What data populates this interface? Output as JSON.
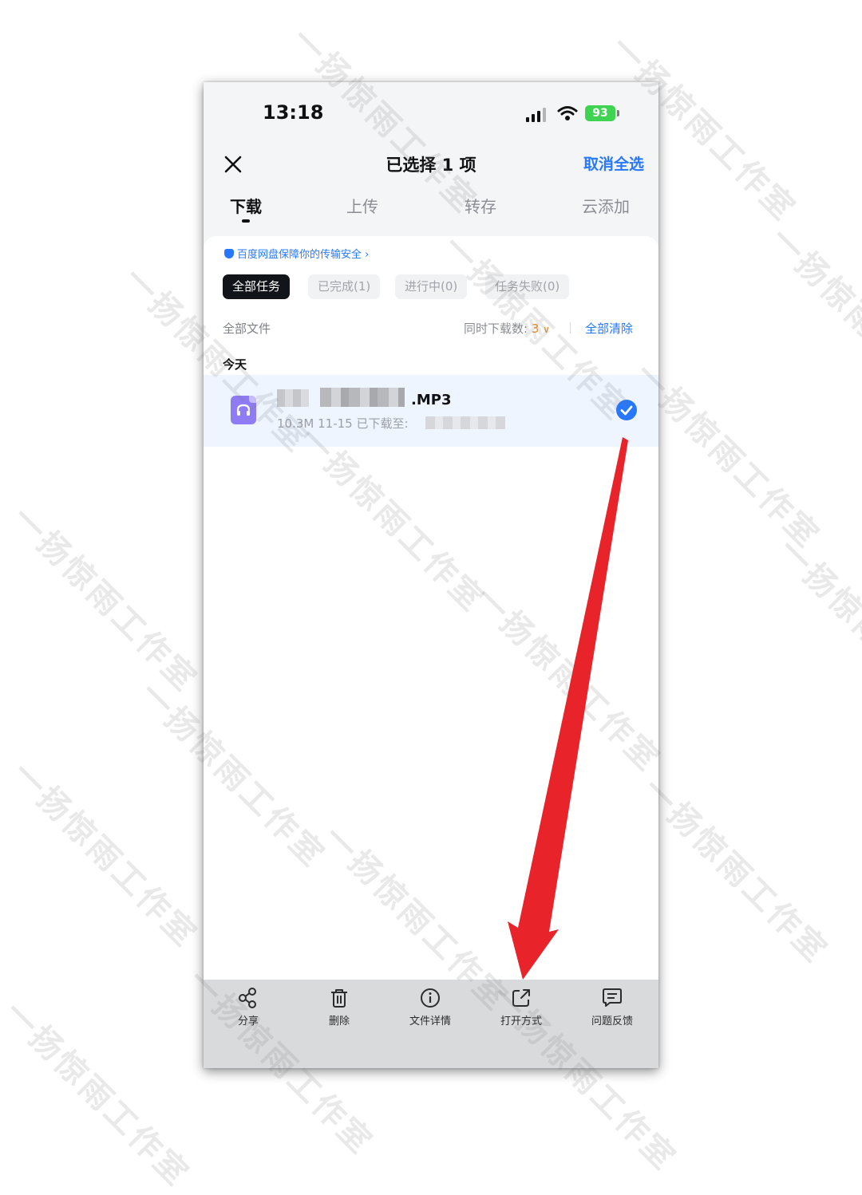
{
  "watermark_text": "一扬惊雨工作室",
  "status_bar": {
    "time": "13:18",
    "battery": "93"
  },
  "nav": {
    "title": "已选择 1 项",
    "cancel_all": "取消全选"
  },
  "tabs": [
    {
      "label": "下载",
      "active": true
    },
    {
      "label": "上传"
    },
    {
      "label": "转存"
    },
    {
      "label": "云添加"
    }
  ],
  "security_note": "百度网盘保障你的传输安全 ›",
  "filters": [
    {
      "label": "全部任务",
      "active": true
    },
    {
      "label": "已完成(1)"
    },
    {
      "label": "进行中(0)"
    },
    {
      "label": "任务失败(0)"
    }
  ],
  "list_header": {
    "all_files": "全部文件",
    "concurrent_label": "同时下载数: ",
    "concurrent_value": "3",
    "clear_all": "全部清除"
  },
  "section_today": "今天",
  "file": {
    "extension": ".MP3",
    "meta": "10.3M  11-15  已下载至:",
    "selected": true
  },
  "actions": [
    {
      "label": "分享",
      "icon": "share-icon"
    },
    {
      "label": "删除",
      "icon": "trash-icon"
    },
    {
      "label": "文件详情",
      "icon": "info-icon"
    },
    {
      "label": "打开方式",
      "icon": "open-with-icon"
    },
    {
      "label": "问题反馈",
      "icon": "feedback-icon"
    }
  ],
  "colors": {
    "accent": "#2878ff",
    "arrow": "#e8232a",
    "orange": "#f08a1c"
  }
}
